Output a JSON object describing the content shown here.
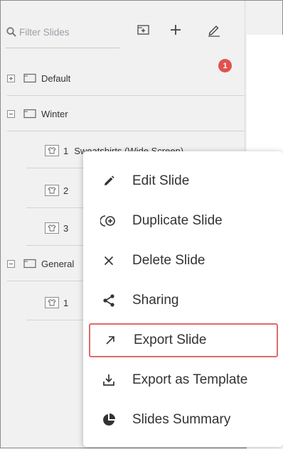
{
  "search": {
    "placeholder": "Filter Slides",
    "value": ""
  },
  "toolbar": {
    "icons": [
      "search-icon",
      "add-folder-icon",
      "plus-icon",
      "pencil-icon"
    ]
  },
  "notification": {
    "count": "1"
  },
  "tree": {
    "groups": [
      {
        "label": "Default",
        "expanded": false
      },
      {
        "label": "Winter",
        "expanded": true,
        "slides": [
          {
            "num": "1",
            "title": "Sweatshirts (Wide Screen)"
          },
          {
            "num": "2",
            "title": ""
          },
          {
            "num": "3",
            "title": ""
          }
        ]
      },
      {
        "label": "General",
        "expanded": true,
        "slides": [
          {
            "num": "1",
            "title": ""
          }
        ]
      }
    ]
  },
  "context_menu": {
    "items": [
      {
        "label": "Edit Slide",
        "icon": "pencil-icon"
      },
      {
        "label": "Duplicate Slide",
        "icon": "duplicate-icon"
      },
      {
        "label": "Delete Slide",
        "icon": "close-icon"
      },
      {
        "label": "Sharing",
        "icon": "share-icon"
      },
      {
        "label": "Export Slide",
        "icon": "export-arrow-icon",
        "highlighted": true
      },
      {
        "label": "Export as Template",
        "icon": "download-tray-icon"
      },
      {
        "label": "Slides Summary",
        "icon": "pie-chart-icon"
      }
    ]
  },
  "colors": {
    "highlight_border": "#e06a69",
    "badge": "#e0524f",
    "panel_bg": "#f1f1f1"
  }
}
